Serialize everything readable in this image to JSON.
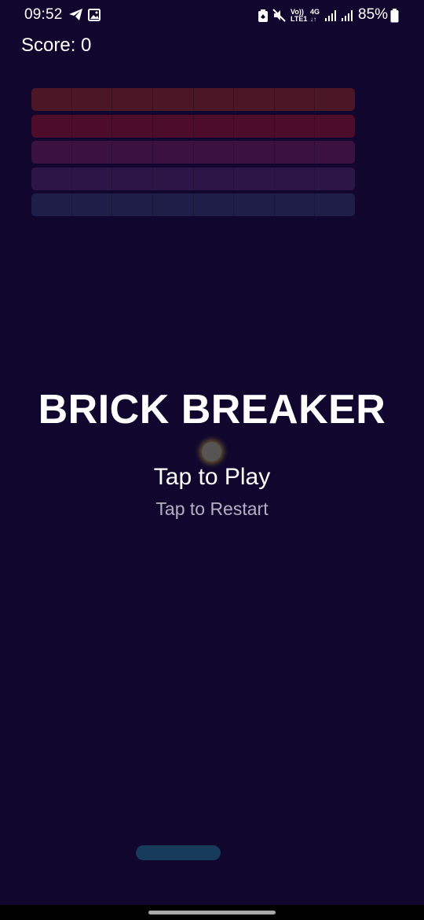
{
  "status_bar": {
    "time": "09:52",
    "network_label_top": "Vo))",
    "network_label_bottom": "LTE1",
    "network_type": "4G",
    "battery": "85%",
    "icons": [
      "telegram-icon",
      "gallery-icon",
      "battery-saver-icon",
      "mute-icon",
      "volte-icon",
      "signal-icon",
      "signal-icon",
      "battery-icon"
    ]
  },
  "game": {
    "score_label": "Score: 0",
    "title": "BRICK BREAKER",
    "tap_to_play": "Tap to Play",
    "tap_to_restart": "Tap to Restart",
    "brick_columns": 8,
    "brick_row_colors": [
      "#4b1625",
      "#4c0c2a",
      "#3b113f",
      "#2c1647",
      "#1f1e49"
    ],
    "ball_color": "#575553",
    "paddle_color": "#163a5a",
    "background_color": "#11072e"
  }
}
